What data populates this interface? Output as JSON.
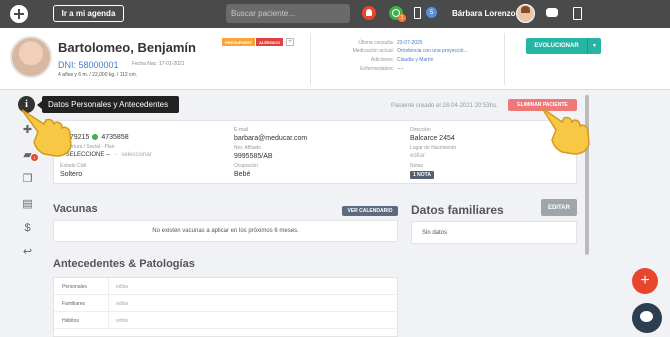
{
  "topbar": {
    "agenda_label": "Ir a mi agenda",
    "search_placeholder": "Buscar paciente...",
    "whatsapp_badge": "1",
    "phone_badge": "5",
    "username": "Bárbara Lorenzo"
  },
  "patient": {
    "name": "Bartolomeo, Benjamín",
    "badge_presupuest": "PRESUPUEST",
    "badge_alergico": "ALÉRGICO",
    "badge_more": "+",
    "dni": "DNI: 58000001",
    "fecha_nac": "Fecha Nac: 17-01-2021",
    "age_info": "4 años y 6 m. / 22,000 kg. / 112 cm.",
    "ultima_consulta_label": "Última consulta:",
    "ultima_consulta_value": "23-07-2025",
    "medicacion_label": "Medicación actual:",
    "medicacion_value": "Ortodoncia con una proyecció...",
    "adiciones_label": "Adiciones:",
    "adiciones_value": "Claudia y Martín",
    "enfermedades_label": "Enfermedades:",
    "enfermedades_value": "----",
    "evolucionar_label": "EVOLUCIONAR"
  },
  "sidebar": {
    "tooltip": "Datos Personales y Antecedentes",
    "folder_badge": "1"
  },
  "main": {
    "created_text": "Paciente creado el 28-04-2021 20:53hs.",
    "eliminar_label": "ELIMINAR PACIENTE",
    "fields": {
      "phone_value": "479215",
      "phone2_value": "4735858",
      "cobertura_label": "Cobertura / Social - Plan",
      "cobertura_value": "-- SELECCIONE --",
      "cobertura_sep": "-",
      "cobertura_link": "seleccionar",
      "estado_label": "Estado Civil",
      "estado_value": "Soltero",
      "email_label": "E-mail",
      "email_value": "barbara@meducar.com",
      "afiliado_label": "Nro. Afiliado",
      "afiliado_value": "9995585/AB",
      "ocupacion_label": "Ocupación",
      "ocupacion_value": "Bebé",
      "direccion_label": "Dirección",
      "direccion_value": "Balcarce 2454",
      "lugar_label": "Lugar de Nacimiento",
      "lugar_link": "editar",
      "notas_label": "Notas",
      "notas_badge": "1 NOTA"
    },
    "vacunas_title": "Vacunas",
    "ver_calendario": "VER CALENDARIO",
    "vacunas_empty": "No existen vacunas a aplicar en los próximos 6 meses.",
    "familiares_title": "Datos familiares",
    "editar_label": "EDITAR",
    "familiares_empty": "Sin datos",
    "antecedentes_title": "Antecedentes & Patologías",
    "antecedentes_rows": [
      {
        "label": "Personales",
        "link": "editar"
      },
      {
        "label": "Familiares",
        "link": "editar"
      },
      {
        "label": "Hábitos",
        "link": "editar"
      }
    ]
  },
  "fab": {
    "plus": "+"
  }
}
